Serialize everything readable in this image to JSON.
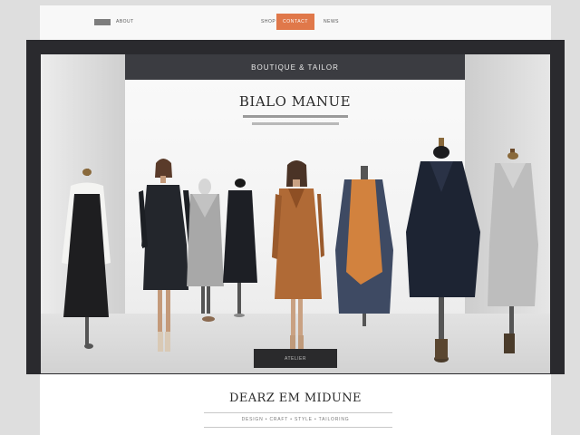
{
  "nav": {
    "links": [
      "ABOUT",
      "SHOP",
      "NEWS"
    ],
    "cta": "CONTACT"
  },
  "banner": {
    "title": "BOUTIQUE & TAILOR"
  },
  "hero": {
    "title": "BIALO MANUE"
  },
  "pedestal": {
    "label": "ATELIER"
  },
  "footer": {
    "title": "DEARZ EM MIDUNE",
    "subtitle": "DESIGN • CRAFT • STYLE • TAILORING"
  },
  "colors": {
    "accent": "#e0784a",
    "frame": "#2a2a2e",
    "banner": "#3b3c41"
  }
}
